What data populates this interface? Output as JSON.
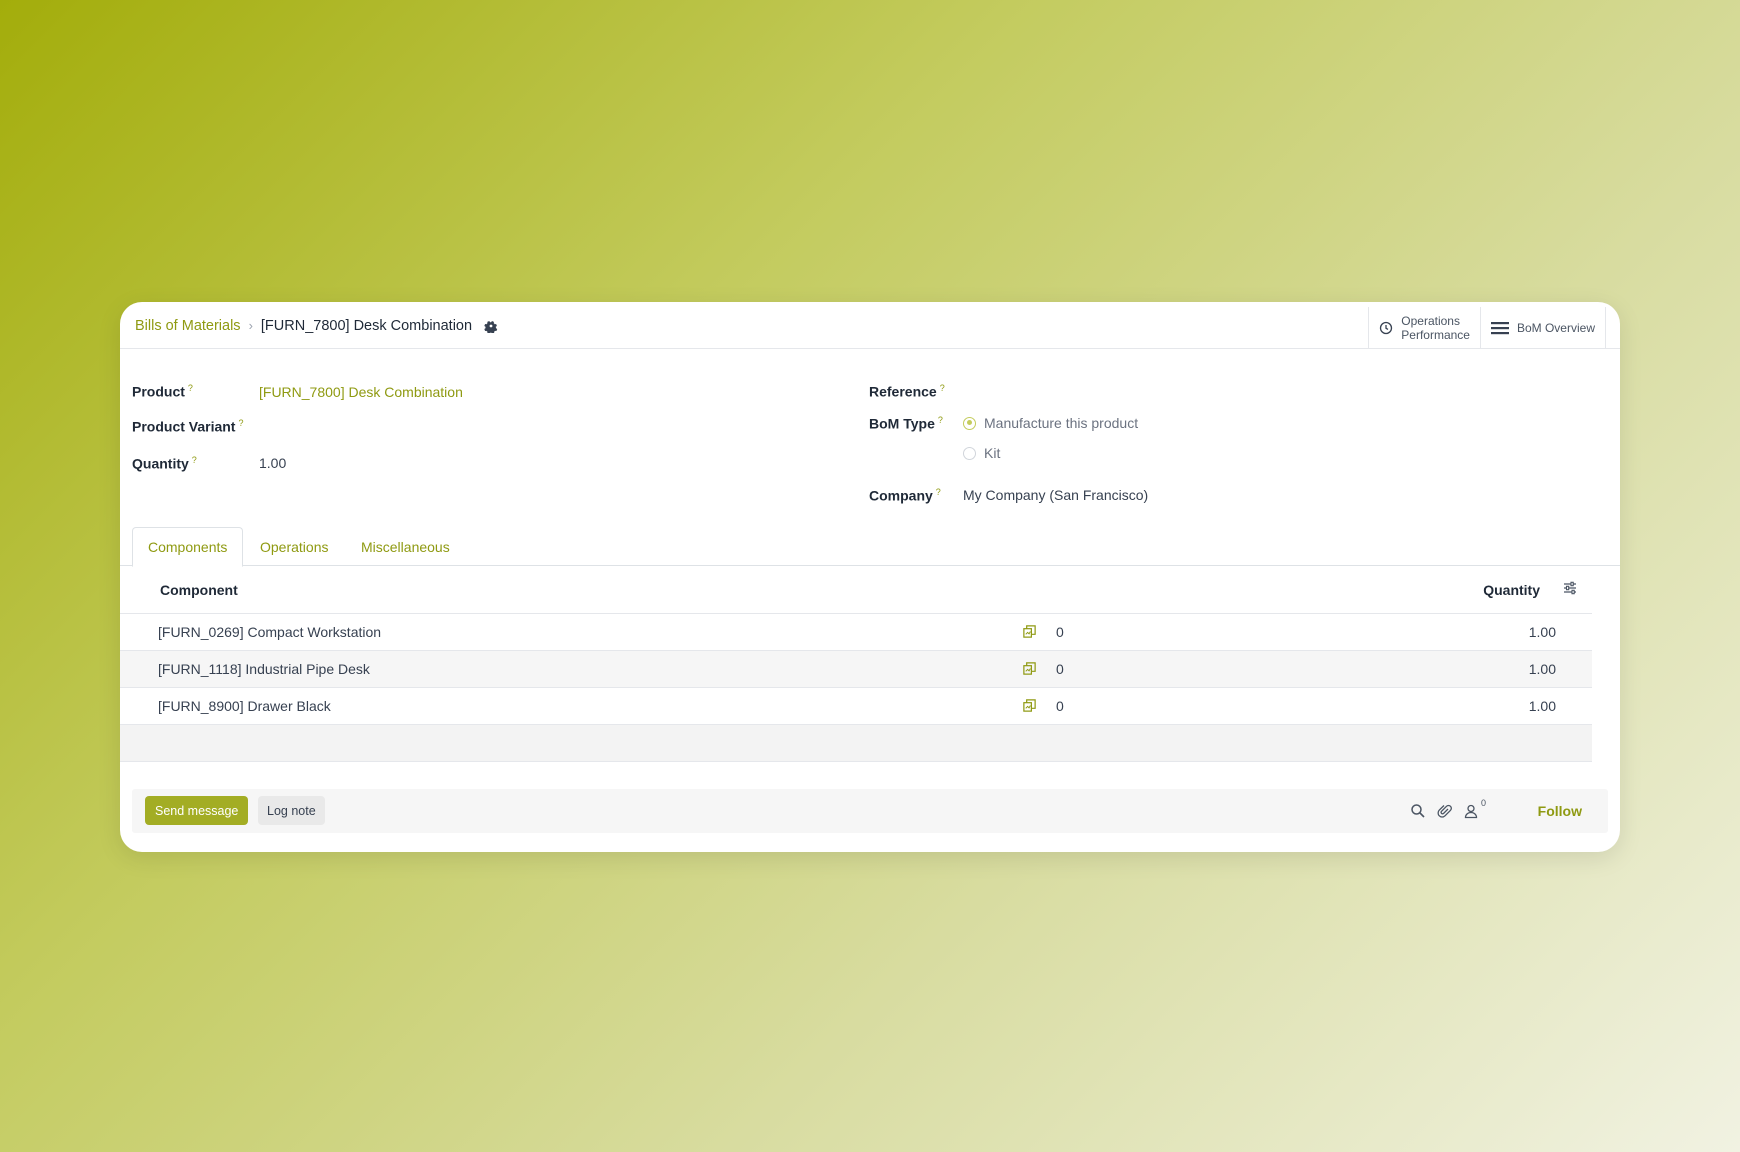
{
  "breadcrumb": {
    "parent": "Bills of Materials",
    "current": "[FURN_7800] Desk Combination"
  },
  "top_actions": {
    "operations_performance_line1": "Operations",
    "operations_performance_line2": "Performance",
    "bom_overview": "BoM Overview"
  },
  "form": {
    "product_label": "Product",
    "product_value": "[FURN_7800] Desk Combination",
    "product_variant_label": "Product Variant",
    "quantity_label": "Quantity",
    "quantity_value": "1.00",
    "reference_label": "Reference",
    "bom_type_label": "BoM Type",
    "bom_type_options": [
      "Manufacture this product",
      "Kit"
    ],
    "bom_type_selected": "Manufacture this product",
    "company_label": "Company",
    "company_value": "My Company (San Francisco)",
    "help_mark": "?"
  },
  "tabs": [
    "Components",
    "Operations",
    "Miscellaneous"
  ],
  "active_tab": "Components",
  "table": {
    "headers": {
      "component": "Component",
      "quantity": "Quantity"
    },
    "rows": [
      {
        "component": "[FURN_0269] Compact Workstation",
        "available": "0",
        "quantity": "1.00"
      },
      {
        "component": "[FURN_1118] Industrial Pipe Desk",
        "available": "0",
        "quantity": "1.00"
      },
      {
        "component": "[FURN_8900] Drawer Black",
        "available": "0",
        "quantity": "1.00"
      }
    ]
  },
  "chatter": {
    "send_message": "Send message",
    "log_note": "Log note",
    "followers_count": "0",
    "follow": "Follow"
  },
  "colors": {
    "accent": "#8f9a12",
    "primary_button": "#a3ad24"
  }
}
